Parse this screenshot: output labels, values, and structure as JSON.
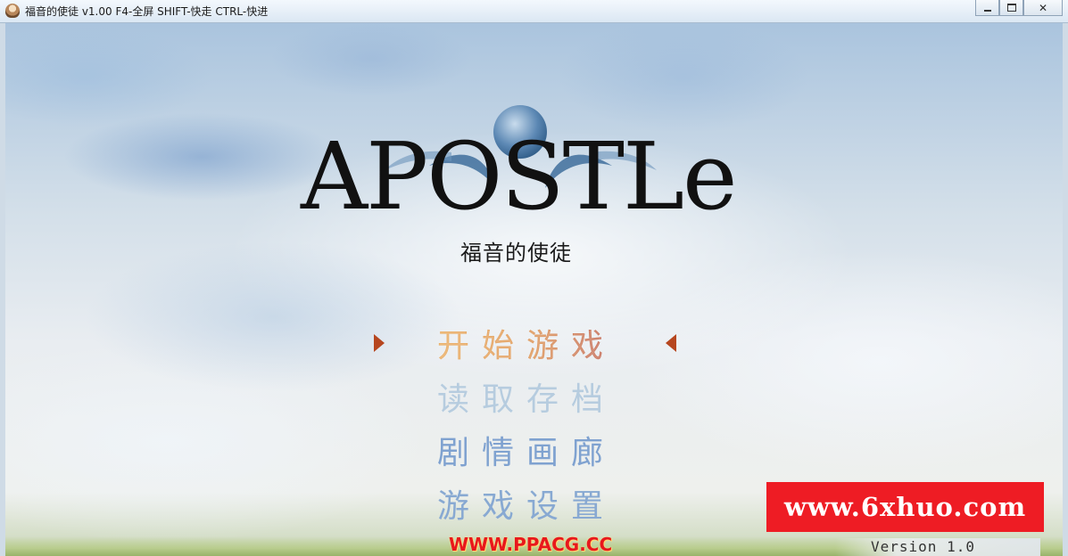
{
  "window": {
    "title": "福音的使徒 v1.00 F4-全屏 SHIFT-快走 CTRL-快进",
    "minimize_label": "",
    "maximize_label": "",
    "close_label": "✕"
  },
  "logo": {
    "wordmark": "APOSTLe",
    "subtitle": "福音的使徒"
  },
  "menu": {
    "items": [
      {
        "label": "开始游戏",
        "state": "selected"
      },
      {
        "label": "读取存档",
        "state": "disabled"
      },
      {
        "label": "剧情画廊",
        "state": "normal"
      },
      {
        "label": "游戏设置",
        "state": "normal"
      }
    ],
    "cursor_icon": "triangle-arrow-icon",
    "selected_color_start": "#e2902b",
    "selected_color_end": "#a3251e"
  },
  "overlays": {
    "watermark": "www.6xhuo.com",
    "watermark_bg": "#ee1c24",
    "site_stamp": "WWW.PPACG.CC",
    "version": "Version 1.0"
  }
}
